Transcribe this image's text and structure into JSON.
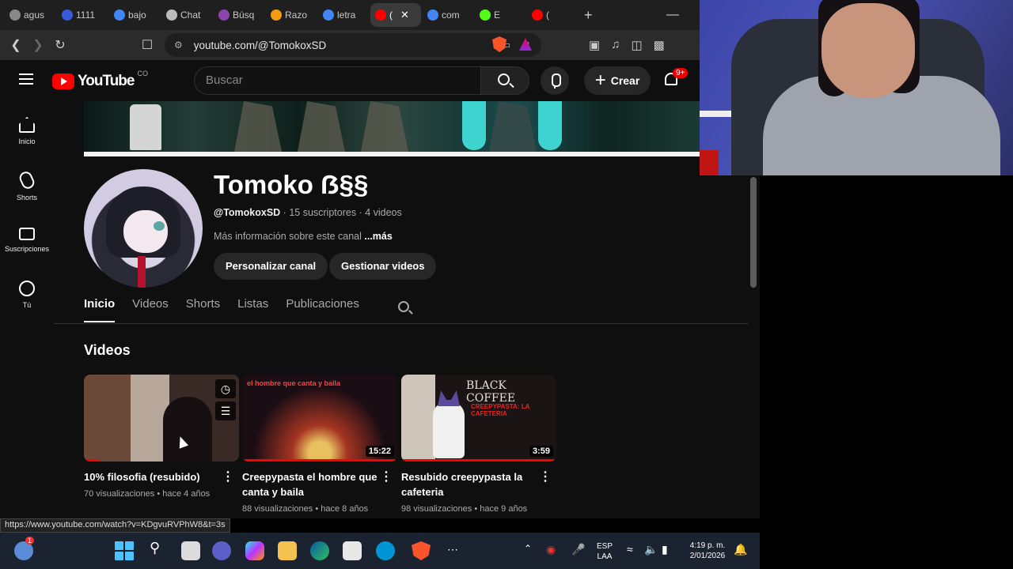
{
  "browser": {
    "tabs": [
      {
        "label": "agus",
        "color": "#888888"
      },
      {
        "label": "1111",
        "color": "#3a5bd9"
      },
      {
        "label": "bajo",
        "color": "#4285f4"
      },
      {
        "label": "Chat",
        "color": "#bbbbbb"
      },
      {
        "label": "Búsq",
        "color": "#8e44ad"
      },
      {
        "label": "Razo",
        "color": "#f39c12"
      },
      {
        "label": "letra",
        "color": "#4285f4"
      },
      {
        "label": "(",
        "color": "#ff0000"
      },
      {
        "label": "com",
        "color": "#4285f4"
      },
      {
        "label": "E",
        "color": "#53fc18"
      },
      {
        "label": "(",
        "color": "#ff0000"
      }
    ],
    "active_tab_close": "✕",
    "new_tab": "+",
    "minimize": "—",
    "url": "youtube.com/@TomokoxSD",
    "status_url": "https://www.youtube.com/watch?v=KDgvuRVPhW8&t=3s"
  },
  "youtube": {
    "logo_text": "YouTube",
    "country_code": "CO",
    "search_placeholder": "Buscar",
    "create_label": "Crear",
    "notif_badge": "9+",
    "guide": [
      {
        "label": "Inicio",
        "icon": "home-icon"
      },
      {
        "label": "Shorts",
        "icon": "shorts-icon"
      },
      {
        "label": "Suscripciones",
        "icon": "subscriptions-icon"
      },
      {
        "label": "Tú",
        "icon": "you-icon"
      }
    ],
    "channel": {
      "name": "Tomoko ẞ§§",
      "handle": "@TomokoxSD",
      "subscribers": "15 suscriptores",
      "videos_count": "4 videos",
      "about": "Más información sobre este canal",
      "more": "...más",
      "customize_button": "Personalizar canal",
      "manage_button": "Gestionar videos"
    },
    "tabs": [
      "Inicio",
      "Videos",
      "Shorts",
      "Listas",
      "Publicaciones"
    ],
    "section_title": "Videos",
    "videos": [
      {
        "title": "10% filosofia (resubido)",
        "views": "70 visualizaciones",
        "age": "hace 4 años",
        "duration": "",
        "watched_fraction": 0.1
      },
      {
        "title": "Creepypasta el hombre que canta y baila",
        "views": "88 visualizaciones",
        "age": "hace 8 años",
        "duration": "15:22",
        "watched_fraction": 1.0
      },
      {
        "title": "Resubido creepypasta la cafeteria",
        "views": "98 visualizaciones",
        "age": "hace 9 años",
        "duration": "3:59",
        "watched_fraction": 1.0
      }
    ],
    "thumb_text_2": "el hombre que canta y baila",
    "thumb_text_3a": "BLACK COFFEE",
    "thumb_text_3b": "CREEPYPASTA: LA CAFETERIA"
  },
  "taskbar": {
    "language": "ESP",
    "layout": "LAA",
    "time": "4:19 p. m.",
    "date": "2/01/2026",
    "weather_badge": "1"
  },
  "colors": {
    "yt_red": "#ff0000",
    "bg": "#0f0f0f",
    "taskbar": "#1c2330"
  }
}
